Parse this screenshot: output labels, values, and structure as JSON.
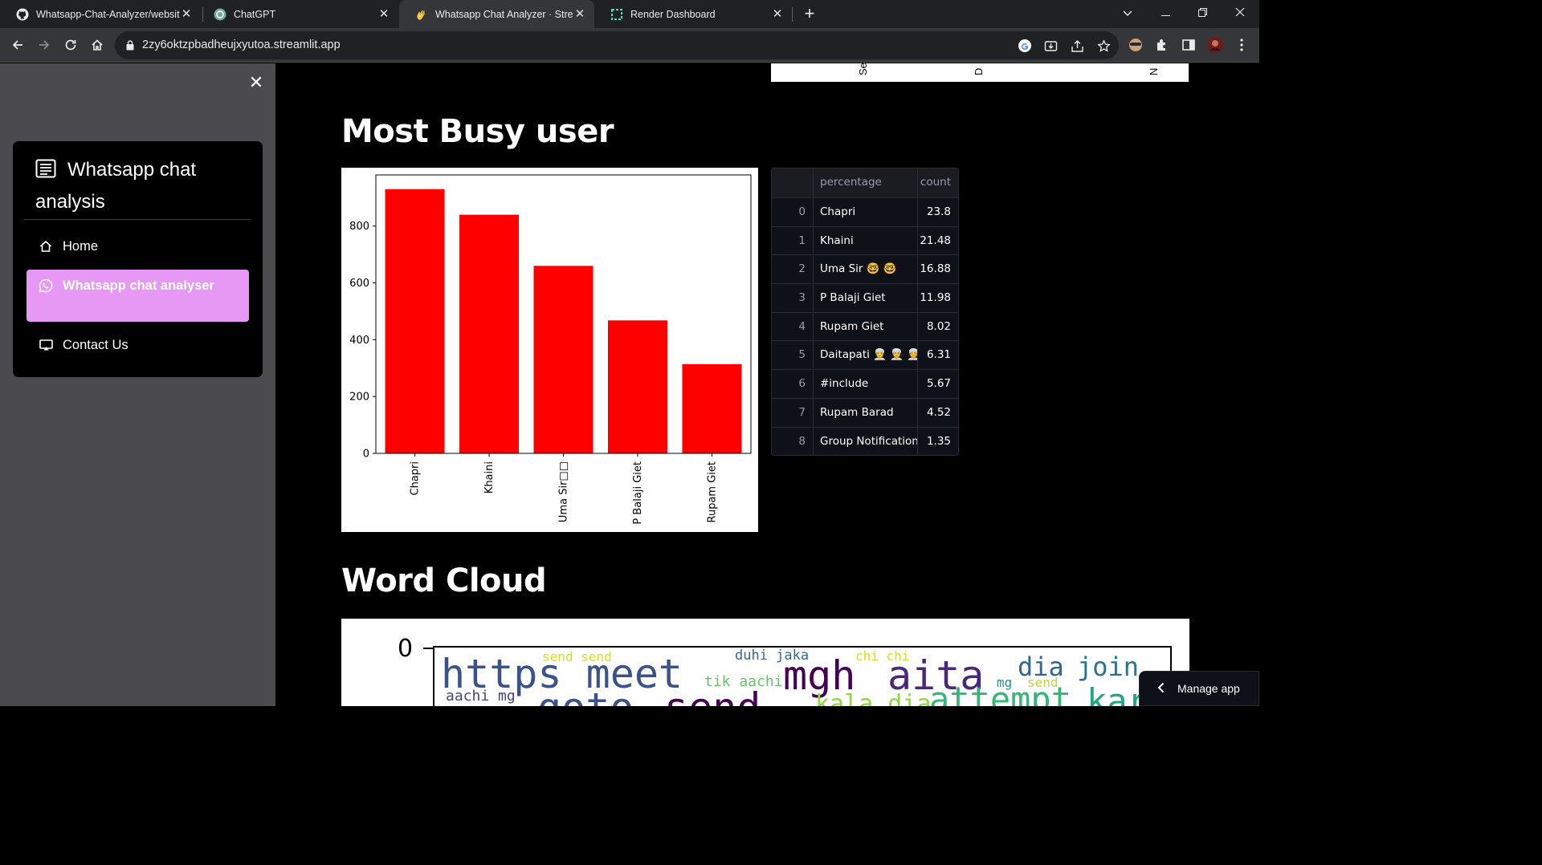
{
  "browser": {
    "tabs": [
      {
        "title": "Whatsapp-Chat-Analyzer/website",
        "favicon": "github-icon",
        "active": false
      },
      {
        "title": "ChatGPT",
        "favicon": "chatgpt-icon",
        "active": false
      },
      {
        "title": "Whatsapp Chat Analyzer · Stream",
        "favicon": "waving-hand-icon",
        "active": true
      },
      {
        "title": "Render Dashboard",
        "favicon": "render-icon",
        "active": false
      }
    ],
    "url": "2zy6oktzpbadheujxyutoa.streamlit.app"
  },
  "sidebar": {
    "title": "Whatsapp chat analysis",
    "title_icon": "list-icon",
    "items": [
      {
        "label": "Home",
        "icon": "home-icon",
        "active": false
      },
      {
        "label": "Whatsapp chat analyser",
        "icon": "whatsapp-icon",
        "active": true
      },
      {
        "label": "Contact Us",
        "icon": "cast-icon",
        "active": false
      }
    ],
    "active_color": "#e797f4"
  },
  "previous_chart": {
    "visible_tick_labels": [
      "Se",
      "D",
      "N"
    ]
  },
  "busy_section": {
    "heading": "Most Busy user"
  },
  "chart_data": {
    "type": "bar",
    "categories": [
      "Chapri",
      "Khaini",
      "Uma Sir🤓🤓",
      "P Balaji Giet",
      "Rupam Giet"
    ],
    "category_labels": [
      "Chapri",
      "Khaini",
      "Uma Sir□□",
      "P Balaji Giet",
      "Rupam Giet"
    ],
    "values": [
      930,
      840,
      660,
      468,
      314
    ],
    "color": "#ff0000",
    "ylim": [
      0,
      980
    ],
    "yticks": [
      0,
      200,
      400,
      600,
      800
    ],
    "xlabel": "",
    "ylabel": "",
    "grid": false
  },
  "table": {
    "columns": [
      "",
      "percentage",
      "count"
    ],
    "rows": [
      {
        "idx": "0",
        "name": "Chapri",
        "value": "23.8"
      },
      {
        "idx": "1",
        "name": "Khaini",
        "value": "21.48"
      },
      {
        "idx": "2",
        "name": "Uma Sir 🤓 🤓",
        "value": "16.88"
      },
      {
        "idx": "3",
        "name": "P Balaji Giet",
        "value": "11.98"
      },
      {
        "idx": "4",
        "name": "Rupam Giet",
        "value": "8.02"
      },
      {
        "idx": "5",
        "name": "Daitapati 👳 👳 👳",
        "value": "6.31"
      },
      {
        "idx": "6",
        "name": "#include",
        "value": "5.67"
      },
      {
        "idx": "7",
        "name": "Rupam Barad",
        "value": "4.52"
      },
      {
        "idx": "8",
        "name": "Group Notification",
        "value": "1.35"
      }
    ]
  },
  "cloud_section": {
    "heading": "Word Cloud",
    "axis_tick": "0",
    "words": [
      {
        "text": "send send",
        "color": "#d8e219"
      },
      {
        "text": "duhi jaka",
        "color": "#31688e"
      },
      {
        "text": "chi chi",
        "color": "#d8e219"
      },
      {
        "text": "https meet",
        "color": "#3b528b"
      },
      {
        "text": "tik aachi",
        "color": "#5ec962"
      },
      {
        "text": "mgh",
        "color": "#440154"
      },
      {
        "text": "aita",
        "color": "#482878"
      },
      {
        "text": "mg",
        "color": "#21918c"
      },
      {
        "text": "dia",
        "color": "#31688e"
      },
      {
        "text": "join",
        "color": "#2c728e"
      },
      {
        "text": "send",
        "color": "#b5de2b"
      },
      {
        "text": "aachi mg",
        "color": "#414487"
      },
      {
        "text": "goto",
        "color": "#3b528b"
      },
      {
        "text": "send",
        "color": "#440154"
      },
      {
        "text": "kala dia",
        "color": "#90d743"
      },
      {
        "text": "attempt",
        "color": "#35b779"
      },
      {
        "text": "kar",
        "color": "#21a585"
      }
    ]
  },
  "manage_app": {
    "label": "Manage app"
  }
}
